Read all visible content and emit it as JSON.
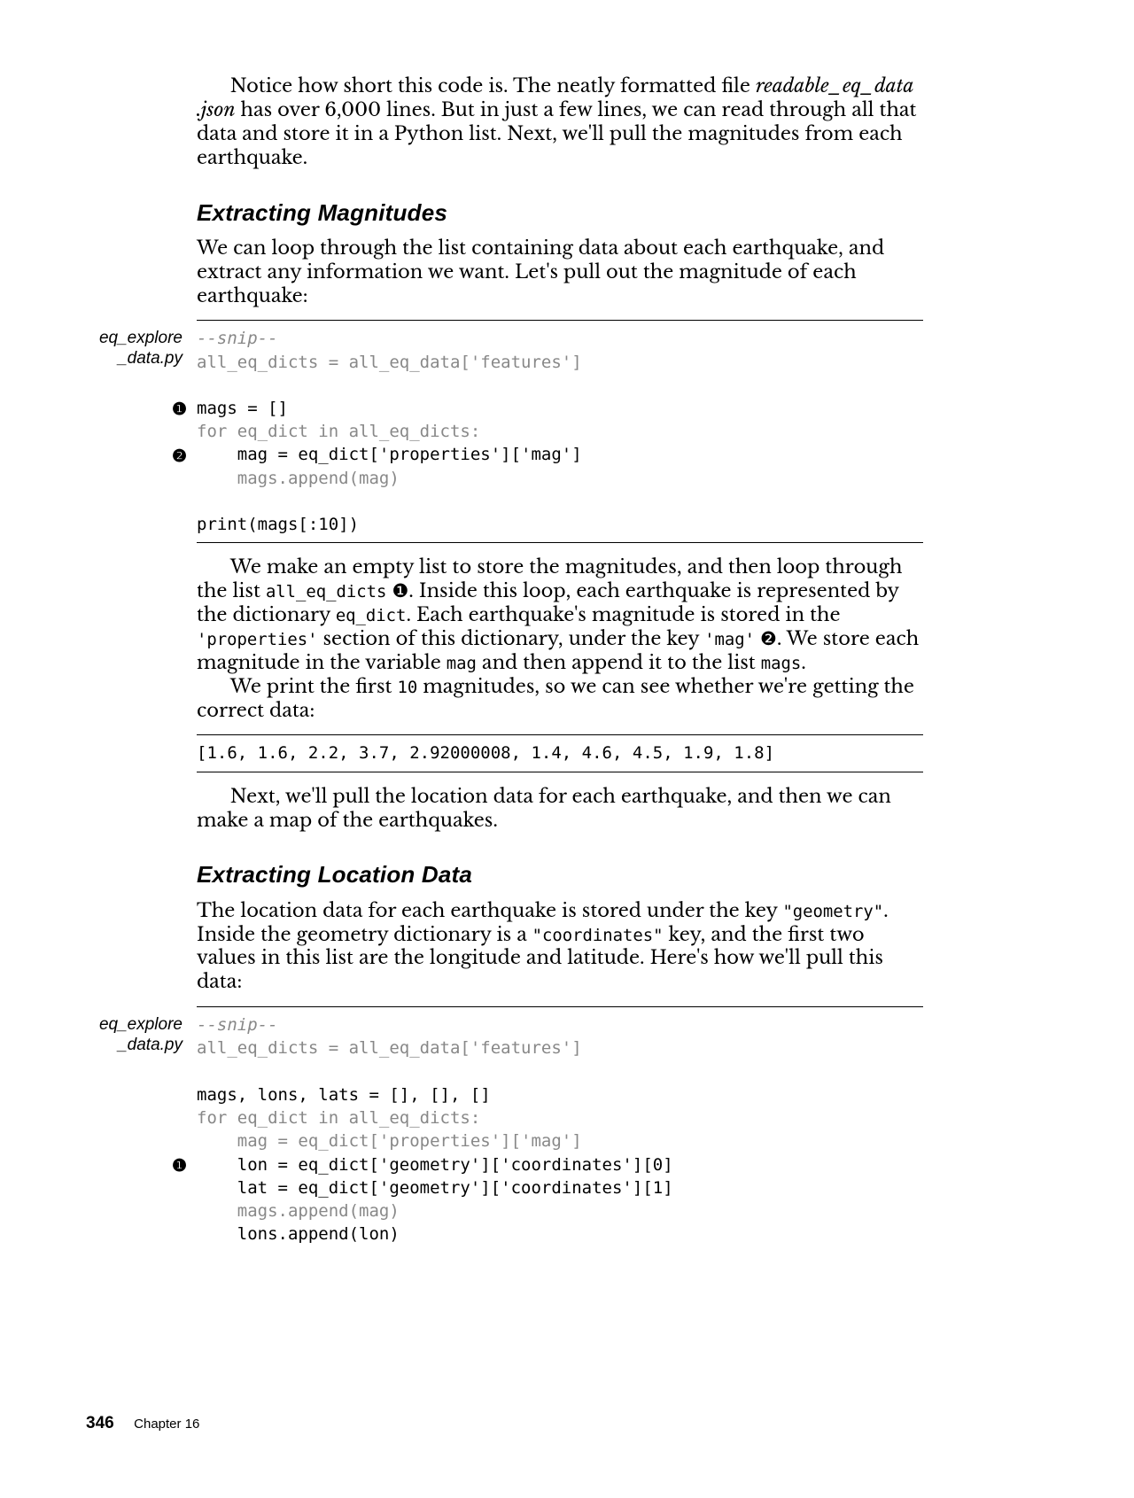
{
  "intro": {
    "part1": "Notice how short this code is. The neatly formatted file ",
    "file_italic": "readable_eq_data .json",
    "part2": " has over 6,000 lines. But in just a few lines, we can read through all that data and store it in a Python list. Next, we'll pull the magnitudes from each earthquake."
  },
  "heading1": "Extracting Magnitudes",
  "p1": "We can loop through the list containing data about each earthquake, and extract any information we want. Let's pull out the magnitude of each earthquake:",
  "sidelabel1": "eq_explore _data.py",
  "code1": {
    "snip": "--snip--",
    "l2": "all_eq_dicts = all_eq_data['features']",
    "l3": "mags = []",
    "l4": "for eq_dict in all_eq_dicts:",
    "l5": "    mag = eq_dict['properties']['mag']",
    "l6": "    mags.append(mag)",
    "l7": "print(mags[:10])",
    "callout1": "❶",
    "callout2": "❷"
  },
  "p2": {
    "a": "We make an empty list to store the magnitudes, and then loop through the list ",
    "b": "all_eq_dicts",
    "c": " ❶. Inside this loop, each earthquake is represented by the dictionary ",
    "d": "eq_dict",
    "e": ". Each earthquake's magnitude is stored in the ",
    "f": "'properties'",
    "g": " section of this dictionary, under the key ",
    "h": "'mag'",
    "i": " ❷. We store each magnitude in the variable ",
    "j": "mag",
    "k": " and then append it to the list ",
    "l": "mags",
    "m": "."
  },
  "p3a": "We print the first ",
  "p3b": "10",
  "p3c": " magnitudes, so we can see whether we're getting the correct data:",
  "code2": "[1.6, 1.6, 2.2, 3.7, 2.92000008, 1.4, 4.6, 4.5, 1.9, 1.8]",
  "p4": "Next, we'll pull the location data for each earthquake, and then we can make a map of the earthquakes.",
  "heading2": "Extracting Location Data",
  "p5a": "The location data for each earthquake is stored under the key ",
  "p5b": "\"geometry\"",
  "p5c": ". Inside the geometry dictionary is a ",
  "p5d": "\"coordinates\"",
  "p5e": " key, and the first two values in this list are the longitude and latitude. Here's how we'll pull this data:",
  "sidelabel2": "eq_explore _data.py",
  "code3": {
    "snip": "--snip--",
    "l2": "all_eq_dicts = all_eq_data['features']",
    "l3": "mags, lons, lats = [], [], []",
    "l4": "for eq_dict in all_eq_dicts:",
    "l5": "    mag = eq_dict['properties']['mag']",
    "l6": "    lon = eq_dict['geometry']['coordinates'][0]",
    "l7": "    lat = eq_dict['geometry']['coordinates'][1]",
    "l8": "    mags.append(mag)",
    "l9": "    lons.append(lon)",
    "callout1": "❶"
  },
  "footer": {
    "page": "346",
    "chapter": "Chapter 16"
  }
}
